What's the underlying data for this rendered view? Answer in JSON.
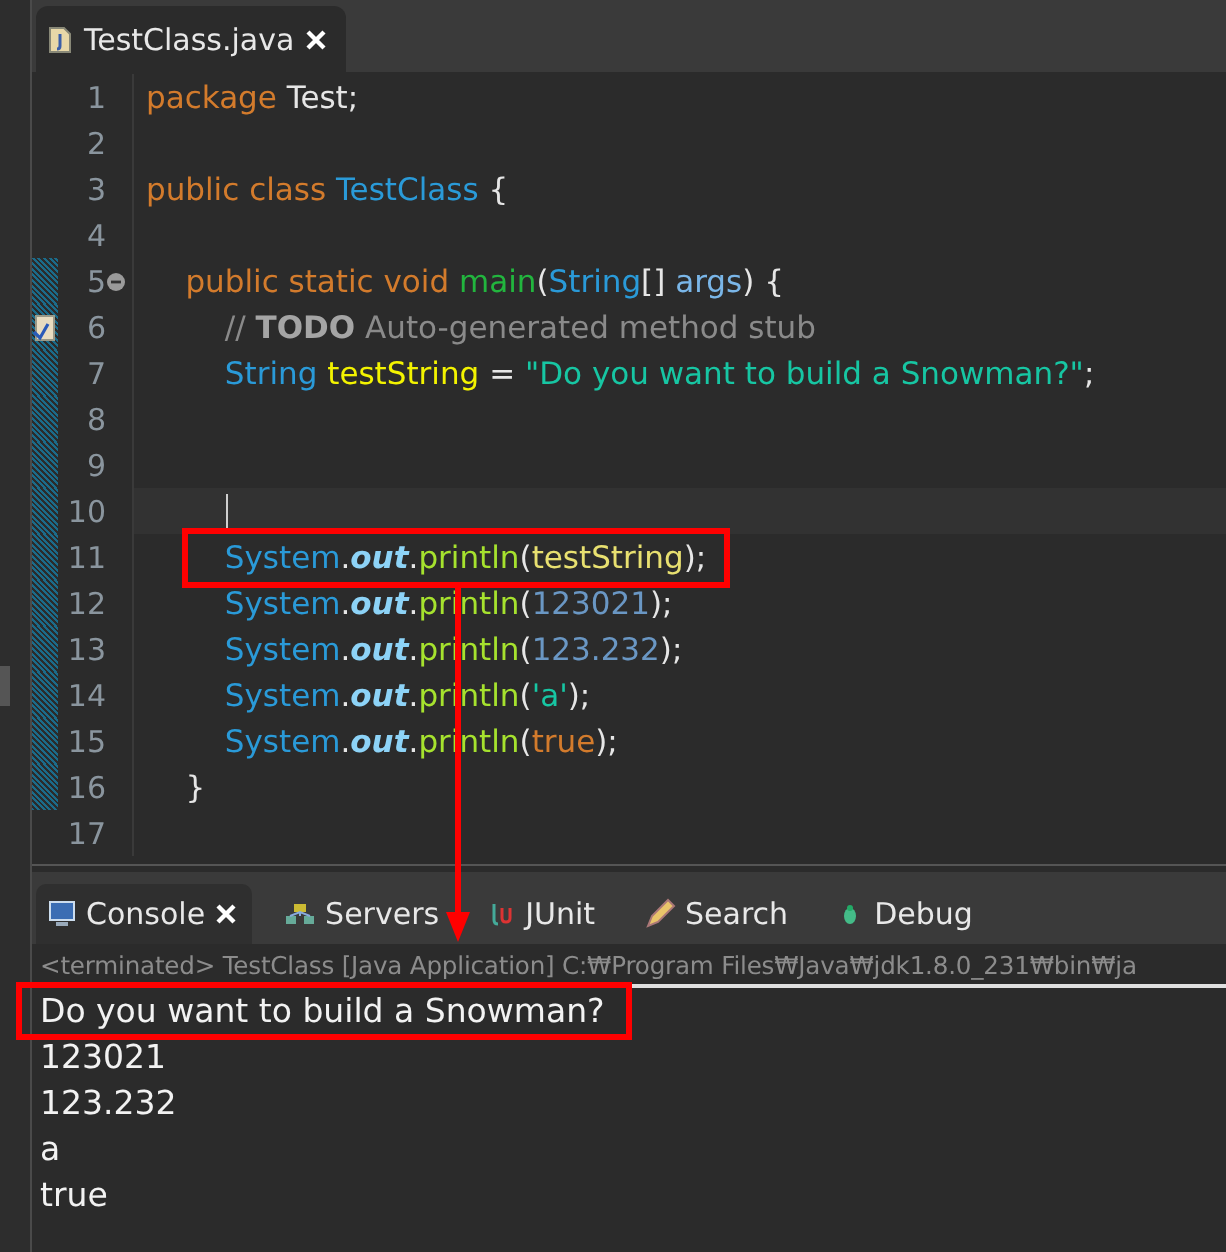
{
  "editor_tab": {
    "title": "TestClass.java",
    "selected": true
  },
  "code_lines": [
    {
      "number": "1",
      "tokens": [
        {
          "kind": "keyword",
          "text": "package"
        },
        {
          "kind": "plain",
          "text": " Test;"
        }
      ]
    },
    {
      "number": "2"
    },
    {
      "number": "3",
      "tokens": [
        {
          "kind": "keyword",
          "text": "public class"
        },
        {
          "kind": "type",
          "text": " TestClass"
        },
        {
          "kind": "plain",
          "text": " {"
        }
      ]
    },
    {
      "number": "4"
    },
    {
      "number": "5",
      "expanded": true,
      "scope": true,
      "tokens": [
        {
          "kind": "keyword",
          "text": "    public static void"
        },
        {
          "kind": "decl",
          "text": " main"
        },
        {
          "kind": "plain",
          "text": "("
        },
        {
          "kind": "type",
          "text": "String"
        },
        {
          "kind": "plain",
          "text": "[] "
        },
        {
          "kind": "param",
          "text": "args"
        },
        {
          "kind": "plain",
          "text": ") {"
        }
      ]
    },
    {
      "number": "6",
      "task": true,
      "scope": true,
      "tokens": [
        {
          "kind": "comment",
          "text": "        // "
        },
        {
          "kind": "todo",
          "text": "TODO"
        },
        {
          "kind": "comment",
          "text": " Auto-generated method stub"
        }
      ]
    },
    {
      "number": "7",
      "scope": true,
      "tokens": [
        {
          "kind": "type",
          "text": "        String"
        },
        {
          "kind": "var",
          "text": " testString"
        },
        {
          "kind": "plain",
          "text": " = "
        },
        {
          "kind": "string",
          "text": "\"Do you want to build a Snowman?\""
        },
        {
          "kind": "plain",
          "text": ";"
        }
      ]
    },
    {
      "number": "8",
      "scope": true
    },
    {
      "number": "9",
      "scope": true
    },
    {
      "number": "10",
      "scope": true,
      "current": true
    },
    {
      "number": "11",
      "scope": true,
      "highlighted": true,
      "tokens": [
        {
          "kind": "type",
          "text": "        System"
        },
        {
          "kind": "plain",
          "text": "."
        },
        {
          "kind": "field",
          "text": "out"
        },
        {
          "kind": "plain",
          "text": "."
        },
        {
          "kind": "call",
          "text": "println"
        },
        {
          "kind": "plain",
          "text": "("
        },
        {
          "kind": "var2",
          "text": "testString"
        },
        {
          "kind": "plain",
          "text": ");"
        }
      ]
    },
    {
      "number": "12",
      "scope": true,
      "tokens": [
        {
          "kind": "type",
          "text": "        System"
        },
        {
          "kind": "plain",
          "text": "."
        },
        {
          "kind": "field",
          "text": "out"
        },
        {
          "kind": "plain",
          "text": "."
        },
        {
          "kind": "call",
          "text": "println"
        },
        {
          "kind": "plain",
          "text": "("
        },
        {
          "kind": "number",
          "text": "123021"
        },
        {
          "kind": "plain",
          "text": ");"
        }
      ]
    },
    {
      "number": "13",
      "scope": true,
      "tokens": [
        {
          "kind": "type",
          "text": "        System"
        },
        {
          "kind": "plain",
          "text": "."
        },
        {
          "kind": "field",
          "text": "out"
        },
        {
          "kind": "plain",
          "text": "."
        },
        {
          "kind": "call",
          "text": "println"
        },
        {
          "kind": "plain",
          "text": "("
        },
        {
          "kind": "number",
          "text": "123.232"
        },
        {
          "kind": "plain",
          "text": ");"
        }
      ]
    },
    {
      "number": "14",
      "scope": true,
      "tokens": [
        {
          "kind": "type",
          "text": "        System"
        },
        {
          "kind": "plain",
          "text": "."
        },
        {
          "kind": "field",
          "text": "out"
        },
        {
          "kind": "plain",
          "text": "."
        },
        {
          "kind": "call",
          "text": "println"
        },
        {
          "kind": "plain",
          "text": "("
        },
        {
          "kind": "string",
          "text": "'a'"
        },
        {
          "kind": "plain",
          "text": ");"
        }
      ]
    },
    {
      "number": "15",
      "scope": true,
      "tokens": [
        {
          "kind": "type",
          "text": "        System"
        },
        {
          "kind": "plain",
          "text": "."
        },
        {
          "kind": "field",
          "text": "out"
        },
        {
          "kind": "plain",
          "text": "."
        },
        {
          "kind": "call",
          "text": "println"
        },
        {
          "kind": "plain",
          "text": "("
        },
        {
          "kind": "keyword",
          "text": "true"
        },
        {
          "kind": "plain",
          "text": ");"
        }
      ]
    },
    {
      "number": "16",
      "scope": true,
      "tokens": [
        {
          "kind": "plain",
          "text": "    }"
        }
      ]
    },
    {
      "number": "17"
    }
  ],
  "console_tabs": [
    {
      "label": "Console",
      "selected": true
    },
    {
      "label": "Servers",
      "selected": false
    },
    {
      "label": "JUnit",
      "selected": false
    },
    {
      "label": "Search",
      "selected": false
    },
    {
      "label": "Debug",
      "selected": false
    }
  ],
  "console_header": "<terminated> TestClass [Java Application] C:₩Program Files₩Java₩jdk1.8.0_231₩bin₩ja",
  "console_output": [
    {
      "text": "Do you want to build a Snowman?",
      "highlighted": true
    },
    {
      "text": "123021",
      "highlighted": false
    },
    {
      "text": "123.232",
      "highlighted": false
    },
    {
      "text": "a",
      "highlighted": false
    },
    {
      "text": "true",
      "highlighted": false
    }
  ]
}
